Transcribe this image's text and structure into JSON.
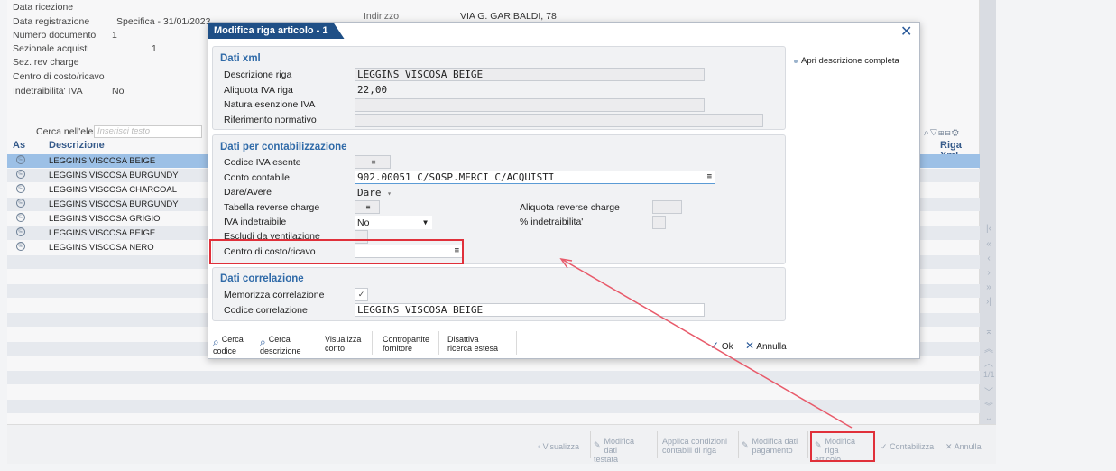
{
  "background": {
    "info_rows": [
      {
        "label": "Data ricezione",
        "value": ""
      },
      {
        "label": "Data registrazione",
        "value": "Specifica - 31/01/2023"
      },
      {
        "label": "Numero documento",
        "value": "1"
      },
      {
        "label": "Sezionale acquisti",
        "value": "1"
      },
      {
        "label": "Sez. rev charge",
        "value": ""
      },
      {
        "label": "Centro di costo/ricavo",
        "value": ""
      },
      {
        "label": "Indetraibilita' IVA",
        "value": "No"
      }
    ],
    "address_label": "Indirizzo",
    "address_value": "VIA G. GARIBALDI, 78",
    "search_label": "Cerca nell'elenco",
    "search_placeholder": "Inserisci testo",
    "table_headers": {
      "as": "As",
      "descrizione": "Descrizione",
      "riga_xml": "Riga Xml"
    },
    "table_rows": [
      "LEGGINS VISCOSA BEIGE",
      "LEGGINS VISCOSA BURGUNDY",
      "LEGGINS VISCOSA CHARCOAL",
      "LEGGINS VISCOSA BURGUNDY",
      "LEGGINS VISCOSA GRIGIO",
      "LEGGINS VISCOSA BEIGE",
      "LEGGINS VISCOSA NERO"
    ],
    "row_icon": "©",
    "page_indicator": "1/1"
  },
  "bottom_toolbar": {
    "visualizza": "Visualizza",
    "modifica_testata": [
      "Modifica",
      "dati testata"
    ],
    "applica": [
      "Applica condizioni",
      "contabili di riga"
    ],
    "modifica_pagamento": [
      "Modifica dati",
      "pagamento"
    ],
    "modifica_riga": [
      "Modifica",
      "riga articolo"
    ],
    "contabilizza": "Contabilizza",
    "annulla": "Annulla"
  },
  "modal": {
    "title": "Modifica riga articolo - 1",
    "close_icon": "✕",
    "side_link": "Apri descrizione completa",
    "dati_xml": {
      "title": "Dati xml",
      "descrizione_riga_label": "Descrizione riga",
      "descrizione_riga_value": "LEGGINS VISCOSA BEIGE",
      "aliquota_label": "Aliquota IVA riga",
      "aliquota_value": "22,00",
      "natura_label": "Natura esenzione IVA",
      "riferimento_label": "Riferimento normativo"
    },
    "contabilizzazione": {
      "title": "Dati per contabilizzazione",
      "codice_iva_label": "Codice IVA esente",
      "conto_label": "Conto contabile",
      "conto_value": "902.00051 C/SOSP.MERCI C/ACQUISTI",
      "dare_avere_label": "Dare/Avere",
      "dare_avere_value": "Dare",
      "tabella_rc_label": "Tabella reverse charge",
      "aliquota_rc_label": "Aliquota reverse charge",
      "iva_indetraibile_label": "IVA indetraibile",
      "iva_indetraibile_value": "No",
      "perc_indetraibilita_label": "% indetraibilita'",
      "escludi_label": "Escludi da ventilazione",
      "centro_label": "Centro di costo/ricavo"
    },
    "correlazione": {
      "title": "Dati correlazione",
      "memorizza_label": "Memorizza correlazione",
      "codice_label": "Codice correlazione",
      "codice_value": "LEGGINS VISCOSA BEIGE"
    },
    "buttons": {
      "cerca_codice": [
        "Cerca",
        "codice"
      ],
      "cerca_descrizione": [
        "Cerca",
        "descrizione"
      ],
      "visualizza_conto": [
        "Visualizza",
        "conto"
      ],
      "contropartite": [
        "Contropartite",
        "fornitore"
      ],
      "disattiva": [
        "Disattiva",
        "ricerca estesa"
      ],
      "ok": "Ok",
      "annulla": "Annulla"
    }
  },
  "colors": {
    "accent": "#1f4f86",
    "highlight": "#e0303a",
    "selected_row": "#9cc0e6",
    "group_title": "#2f6aa8"
  }
}
